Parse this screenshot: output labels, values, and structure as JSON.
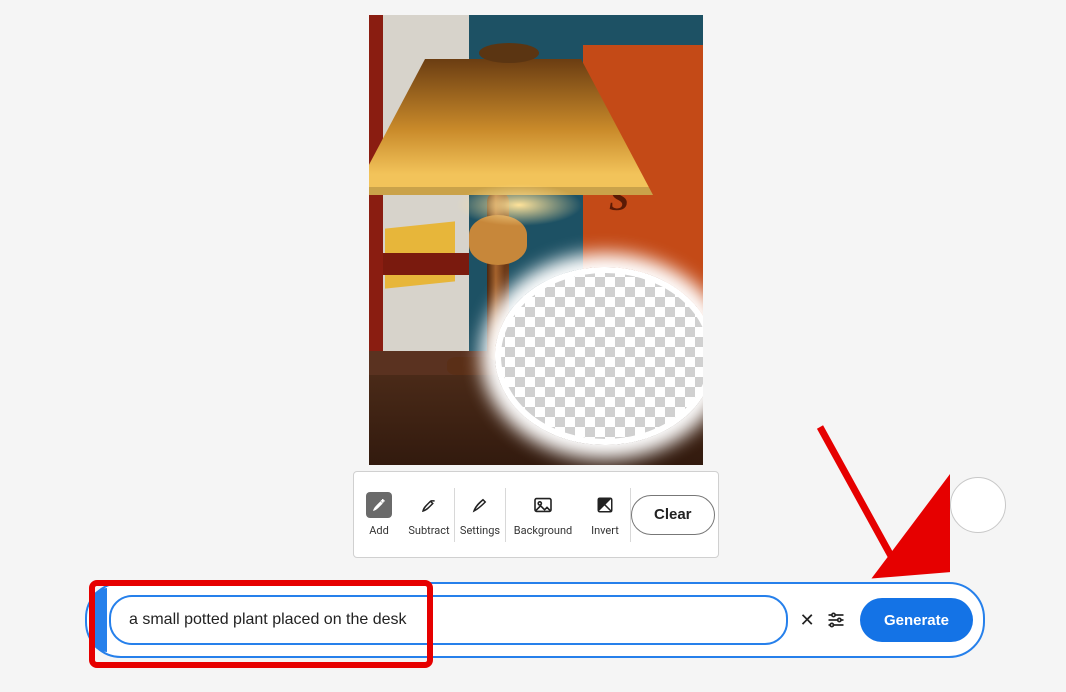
{
  "toolbar": {
    "add": "Add",
    "subtract": "Subtract",
    "settings": "Settings",
    "background": "Background",
    "invert": "Invert",
    "clear": "Clear"
  },
  "prompt": {
    "value": "a small potted plant placed on the desk",
    "generate": "Generate"
  },
  "icons": {
    "add": "brush-plus-icon",
    "subtract": "brush-minus-icon",
    "settings": "brush-icon",
    "background": "image-icon",
    "invert": "invert-icon",
    "clear": "close-icon",
    "sliders": "sliders-icon"
  }
}
